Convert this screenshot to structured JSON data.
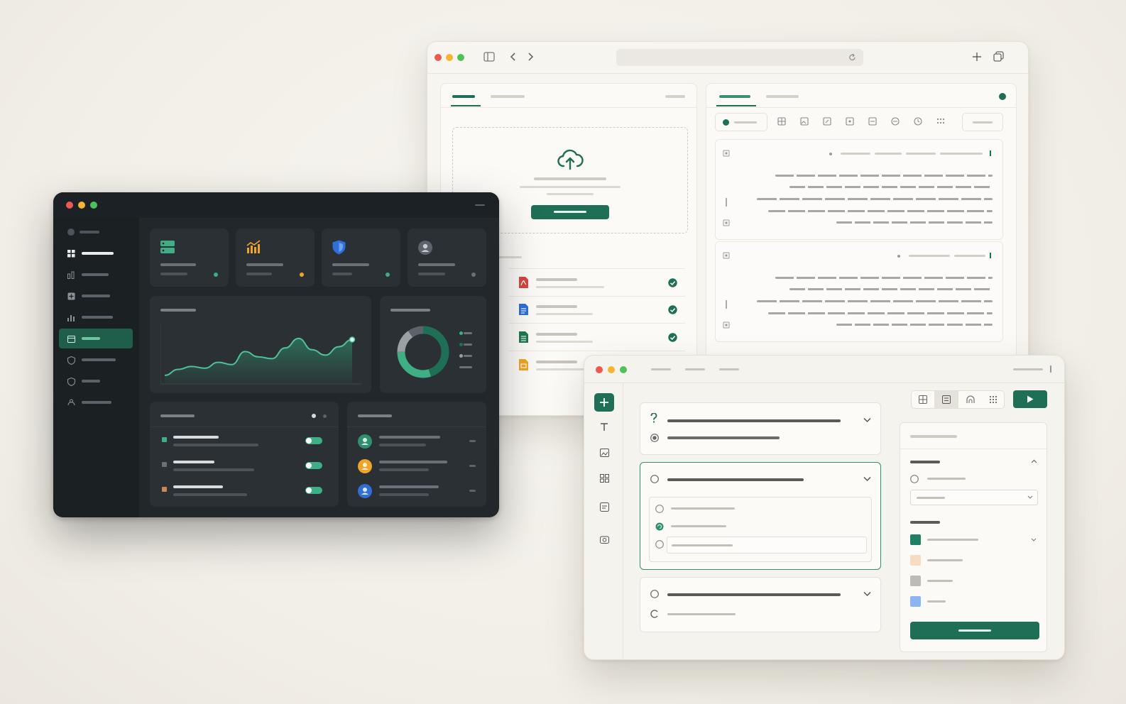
{
  "colors": {
    "accent": "#1f6e56",
    "accent_light": "#3fae85",
    "dark_bg": "#21272b",
    "dark_card": "#2a3034",
    "page_bg": "#f3f0ea",
    "pdf": "#d9463e",
    "doc": "#2f6fd6",
    "sheet": "#1f7a50",
    "slide": "#f0a526",
    "status_amber": "#f0a526",
    "swatch_colors": [
      "#1f7f63",
      "#f8dcc0",
      "#bdbbb6",
      "#8bb5f5"
    ]
  },
  "browser": {
    "icons": [
      "sidebar-toggle-icon",
      "back-arrow-icon",
      "forward-arrow-icon",
      "reload-icon",
      "new-tab-icon",
      "tabs-overview-icon"
    ],
    "upload_icon": "cloud-upload-icon",
    "files": [
      {
        "icon": "pdf-file-icon",
        "status": "check-icon"
      },
      {
        "icon": "doc-file-icon",
        "status": "check-icon"
      },
      {
        "icon": "sheet-file-icon",
        "status": "check-icon"
      },
      {
        "icon": "slides-file-icon",
        "status": ""
      }
    ]
  },
  "dashboard": {
    "sidebar_icons": [
      "dashboard-grid-icon",
      "users-chart-icon",
      "add-box-icon",
      "bar-chart-icon",
      "calendar-icon",
      "shield-icon",
      "shield-outline-icon",
      "support-icon"
    ],
    "active_index": 4,
    "stat_icons": [
      "server-icon",
      "growth-chart-icon",
      "security-shield-icon",
      "user-avatar-icon"
    ],
    "toggles_on": [
      true,
      true,
      true
    ]
  },
  "chart_data": {
    "type": "area",
    "x": [
      0,
      1,
      2,
      3,
      4,
      5,
      6,
      7,
      8,
      9,
      10,
      11,
      12,
      13,
      14
    ],
    "values": [
      12,
      22,
      27,
      24,
      34,
      30,
      52,
      43,
      40,
      58,
      74,
      55,
      46,
      60,
      72
    ],
    "title": "",
    "xlabel": "",
    "ylabel": "",
    "ylim": [
      0,
      100
    ],
    "donut": {
      "type": "pie",
      "values": [
        45,
        30,
        15,
        10
      ]
    }
  },
  "builder": {
    "tool_icons": [
      "add-icon",
      "text-icon",
      "image-icon",
      "grid-icon",
      "document-icon",
      "camera-icon"
    ],
    "view_icons": [
      "table-view-icon",
      "form-view-icon",
      "bridge-icon",
      "apps-icon"
    ],
    "play_icon": "play-icon"
  }
}
